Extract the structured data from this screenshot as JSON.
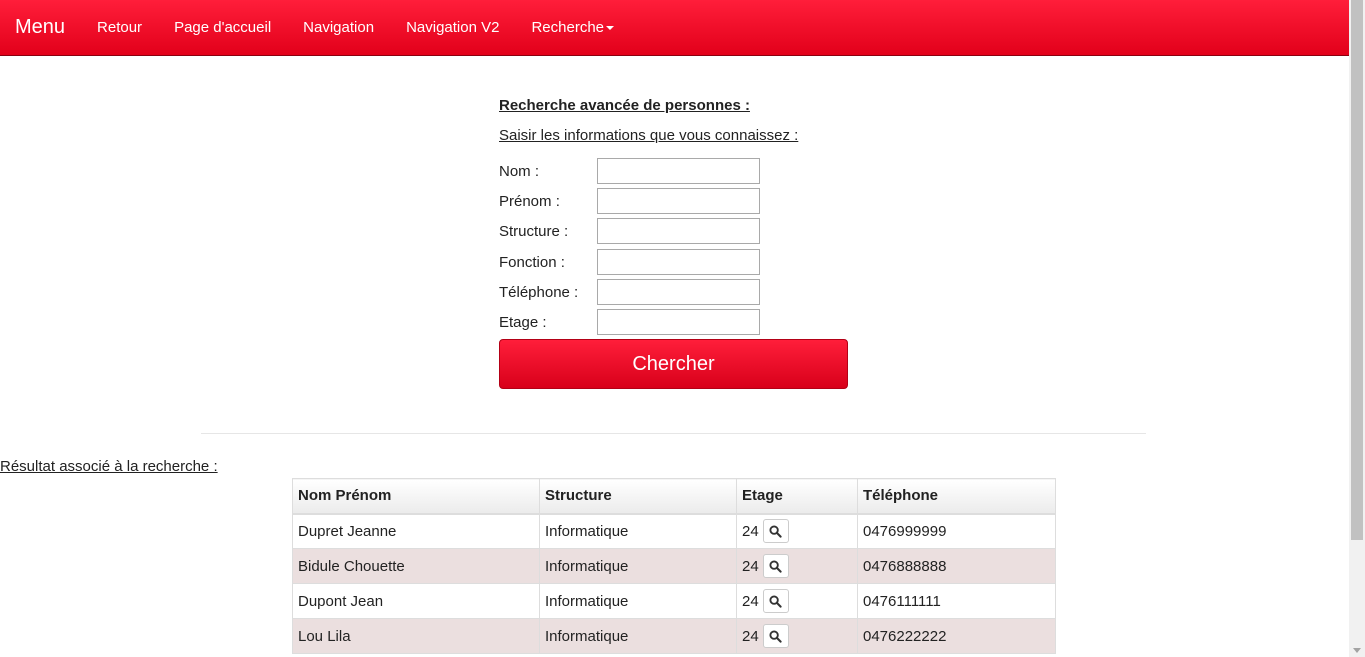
{
  "navbar": {
    "brand": "Menu",
    "links": [
      "Retour",
      "Page d'accueil",
      "Navigation",
      "Navigation V2"
    ],
    "dropdown_label": "Recherche",
    "color": "#e2001a"
  },
  "form": {
    "title": "Recherche avancée de personnes :",
    "subtitle": "Saisir les informations que vous connaissez :",
    "fields": [
      {
        "label": "Nom :",
        "value": ""
      },
      {
        "label": "Prénom :",
        "value": ""
      },
      {
        "label": "Structure :",
        "value": ""
      },
      {
        "label": "Fonction :",
        "value": ""
      },
      {
        "label": "Téléphone :",
        "value": ""
      },
      {
        "label": "Etage :",
        "value": ""
      }
    ],
    "submit_label": "Chercher"
  },
  "results": {
    "label": "Résultat associé à la recherche :",
    "headers": [
      "Nom Prénom",
      "Structure",
      "Etage",
      "Téléphone"
    ],
    "rows": [
      {
        "name": "Dupret Jeanne",
        "structure": "Informatique",
        "etage": "24",
        "telephone": "0476999999"
      },
      {
        "name": "Bidule Chouette",
        "structure": "Informatique",
        "etage": "24",
        "telephone": "0476888888"
      },
      {
        "name": "Dupont Jean",
        "structure": "Informatique",
        "etage": "24",
        "telephone": "0476111111"
      },
      {
        "name": "Lou Lila",
        "structure": "Informatique",
        "etage": "24",
        "telephone": "0476222222"
      }
    ],
    "row_icon": "search-icon"
  }
}
